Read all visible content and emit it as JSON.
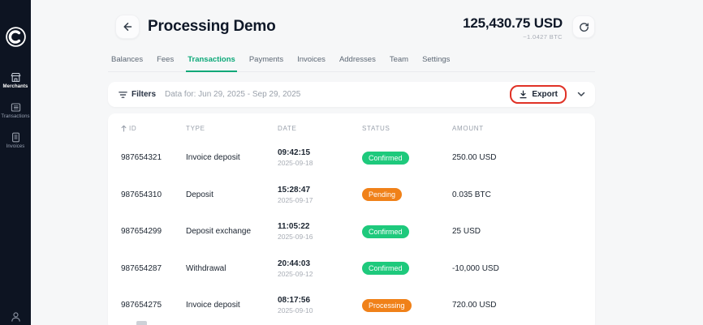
{
  "sidebar": {
    "items": [
      {
        "label": "Merchants",
        "icon": "storefront-icon",
        "active": true
      },
      {
        "label": "Transactions",
        "icon": "list-icon",
        "active": false
      },
      {
        "label": "Invoices",
        "icon": "document-icon",
        "active": false
      }
    ]
  },
  "header": {
    "title": "Processing Demo",
    "balance_primary": "125,430.75 USD",
    "balance_secondary": "~1.0427 BTC"
  },
  "tabs": [
    {
      "label": "Balances",
      "active": false
    },
    {
      "label": "Fees",
      "active": false
    },
    {
      "label": "Transactions",
      "active": true
    },
    {
      "label": "Payments",
      "active": false
    },
    {
      "label": "Invoices",
      "active": false
    },
    {
      "label": "Addresses",
      "active": false
    },
    {
      "label": "Team",
      "active": false
    },
    {
      "label": "Settings",
      "active": false
    }
  ],
  "filter_bar": {
    "filters_label": "Filters",
    "date_range": "Data for: Jun 29, 2025 - Sep 29, 2025",
    "export_label": "Export"
  },
  "table": {
    "columns": [
      "ID",
      "TYPE",
      "DATE",
      "STATUS",
      "AMOUNT"
    ],
    "sorted_column": "ID",
    "rows": [
      {
        "id": "987654321",
        "type": "Invoice deposit",
        "time": "09:42:15",
        "date": "2025-09-18",
        "status": "Confirmed",
        "status_color": "green",
        "amount": "250.00 USD"
      },
      {
        "id": "987654310",
        "type": "Deposit",
        "time": "15:28:47",
        "date": "2025-09-17",
        "status": "Pending",
        "status_color": "orange",
        "amount": "0.035 BTC"
      },
      {
        "id": "987654299",
        "type": "Deposit exchange",
        "time": "11:05:22",
        "date": "2025-09-16",
        "status": "Confirmed",
        "status_color": "green",
        "amount": "25 USD"
      },
      {
        "id": "987654287",
        "type": "Withdrawal",
        "time": "20:44:03",
        "date": "2025-09-12",
        "status": "Confirmed",
        "status_color": "green",
        "amount": "-10,000 USD"
      },
      {
        "id": "987654275",
        "type": "Invoice deposit",
        "time": "08:17:56",
        "date": "2025-09-10",
        "status": "Processing",
        "status_color": "orange",
        "amount": "720.00 USD"
      }
    ]
  },
  "icons": {
    "brand": "crescent-c-logo",
    "back": "arrow-left",
    "refresh": "circular-arrow",
    "filters": "filter-lines",
    "export": "download-arrow",
    "expand": "chevron-down",
    "sort": "arrow-up",
    "profile": "person"
  },
  "colors": {
    "sidebar_bg": "#0d1422",
    "accent_green": "#0ca878",
    "badge_green": "#1ec97c",
    "badge_orange": "#f08119",
    "annotation_red": "#e03226",
    "page_bg": "#f6f7f8"
  }
}
